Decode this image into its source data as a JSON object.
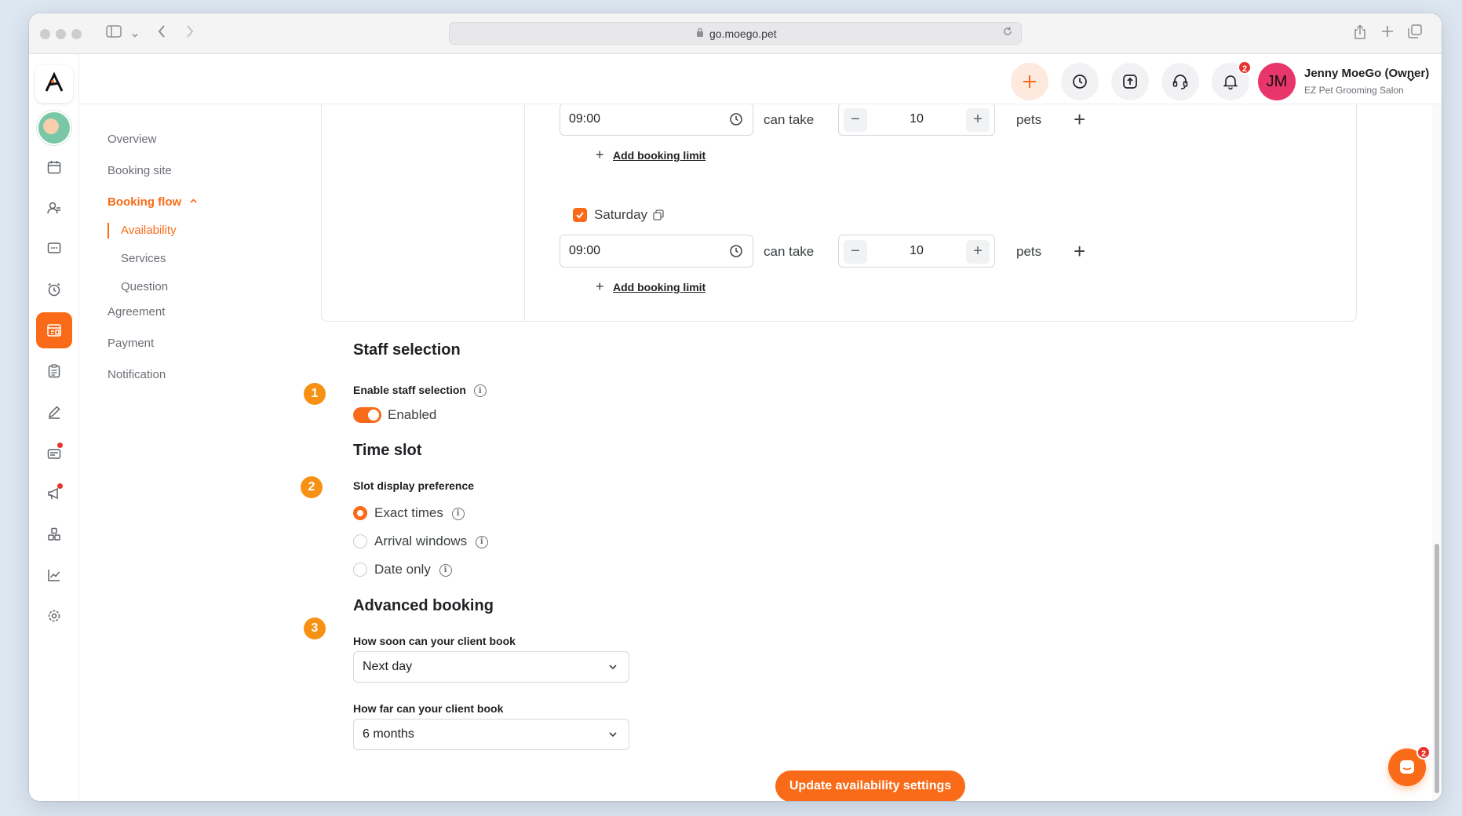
{
  "browser": {
    "url": "go.moego.pet"
  },
  "header": {
    "notification_count": "2",
    "user_initials": "JM",
    "user_name": "Jenny MoeGo (Owner)",
    "business_name": "EZ Pet Grooming Salon"
  },
  "subnav": {
    "overview": "Overview",
    "booking_site": "Booking site",
    "booking_flow": "Booking flow",
    "availability": "Availability",
    "services": "Services",
    "question": "Question",
    "agreement": "Agreement",
    "payment": "Payment",
    "notification": "Notification"
  },
  "schedule": {
    "row1": {
      "time": "09:00",
      "can_take": "can take",
      "count": "10",
      "unit": "pets",
      "add_limit": "Add booking limit"
    },
    "saturday": {
      "day_label": "Saturday",
      "checked": true,
      "time": "09:00",
      "can_take": "can take",
      "count": "10",
      "unit": "pets",
      "add_limit": "Add booking limit"
    }
  },
  "staff_selection": {
    "step": "1",
    "title": "Staff selection",
    "field_label": "Enable staff selection",
    "toggle_state": "Enabled"
  },
  "time_slot": {
    "step": "2",
    "title": "Time slot",
    "field_label": "Slot display preference",
    "options": [
      "Exact times",
      "Arrival windows",
      "Date only"
    ],
    "selected": "Exact times"
  },
  "advanced_booking": {
    "step": "3",
    "title": "Advanced booking",
    "soon_label": "How soon can your client book",
    "soon_value": "Next day",
    "far_label": "How far can your client book",
    "far_value": "6 months"
  },
  "update_button": "Update availability settings",
  "chat_badge": "2",
  "colors": {
    "accent": "#f96b18",
    "step": "#f79114",
    "badge": "#e8332c",
    "avatar": "#e8356a"
  }
}
